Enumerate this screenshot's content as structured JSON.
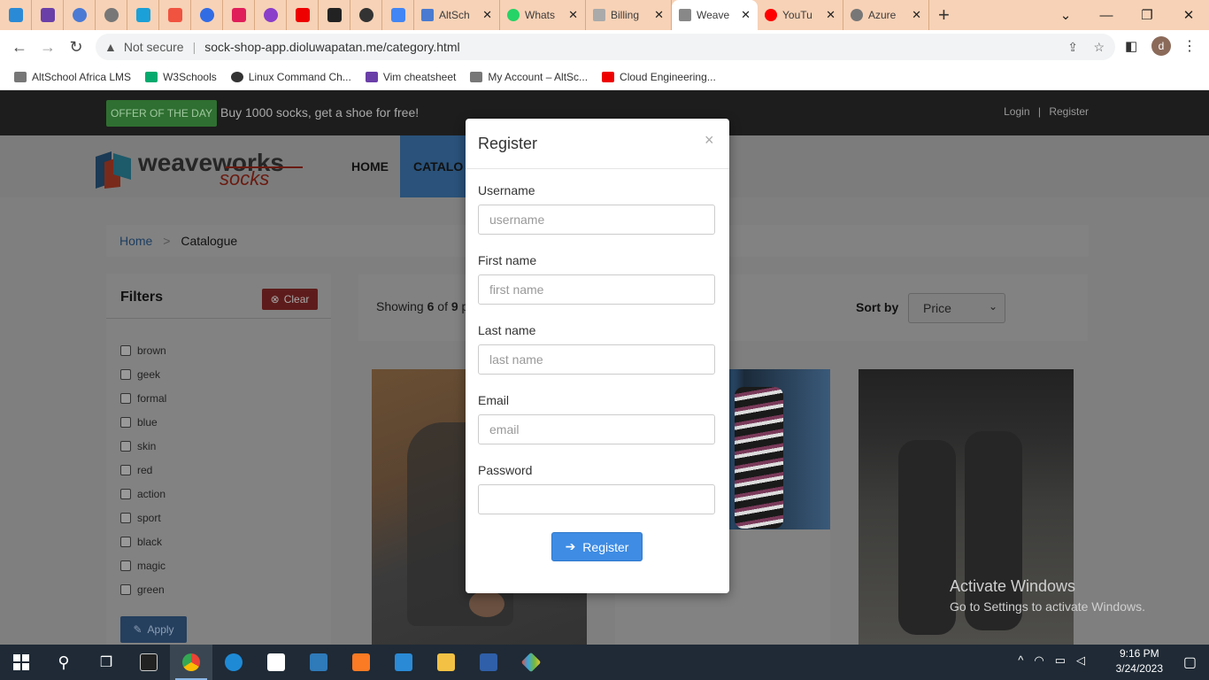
{
  "browser": {
    "tabs": [
      {
        "title": "AltSch",
        "color": "#4a7bd0"
      },
      {
        "title": "Whats",
        "color": "#25d366"
      },
      {
        "title": "Billing",
        "color": "#888888"
      },
      {
        "title": "Weave",
        "color": "#555555",
        "active": true
      },
      {
        "title": "YouTu",
        "color": "#ff0000"
      },
      {
        "title": "Azure",
        "color": "#666666"
      }
    ],
    "security_label": "Not secure",
    "url": "sock-shop-app.dioluwapatan.me/category.html",
    "profile_initial": "d",
    "bookmarks": [
      {
        "label": "AltSchool Africa LMS"
      },
      {
        "label": "W3Schools"
      },
      {
        "label": "Linux Command Ch..."
      },
      {
        "label": "Vim cheatsheet"
      },
      {
        "label": "My Account – AltSc..."
      },
      {
        "label": "Cloud Engineering..."
      }
    ]
  },
  "header": {
    "offer_badge": "OFFER OF THE DAY",
    "offer_text": "Buy 1000 socks, get a shoe for free!",
    "login": "Login",
    "separator": "|",
    "register": "Register",
    "nav_home": "HOME",
    "nav_catalogue": "CATALO"
  },
  "logo": {
    "main": "weaveworks",
    "sub": "socks"
  },
  "breadcrumb": {
    "home": "Home",
    "sep": ">",
    "current": "Catalogue"
  },
  "filters": {
    "title": "Filters",
    "clear": "Clear",
    "apply": "Apply",
    "items": [
      "brown",
      "geek",
      "formal",
      "blue",
      "skin",
      "red",
      "action",
      "sport",
      "black",
      "magic",
      "green"
    ]
  },
  "toolbar": {
    "showing_prefix": "Showing",
    "shown": "6",
    "of": "of",
    "total": "9",
    "tail": "p",
    "sort_label": "Sort by",
    "sort_value": "Price"
  },
  "watermark": {
    "line1": "Activate Windows",
    "line2": "Go to Settings to activate Windows."
  },
  "modal": {
    "title": "Register",
    "close": "×",
    "username_label": "Username",
    "username_placeholder": "username",
    "firstname_label": "First name",
    "firstname_placeholder": "first name",
    "lastname_label": "Last name",
    "lastname_placeholder": "last name",
    "email_label": "Email",
    "email_placeholder": "email",
    "password_label": "Password",
    "submit": "Register"
  },
  "taskbar": {
    "time": "9:16 PM",
    "date": "3/24/2023"
  }
}
